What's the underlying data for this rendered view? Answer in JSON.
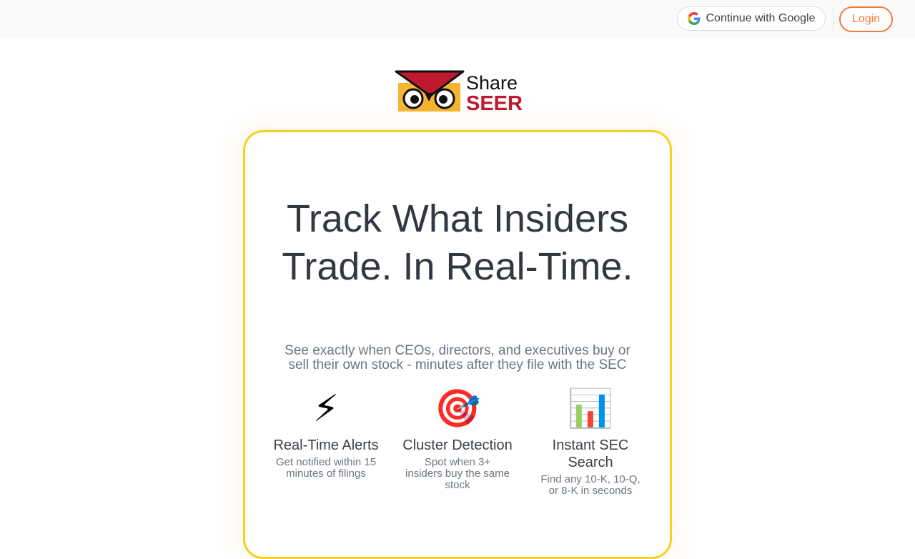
{
  "header": {
    "google_button_label": "Continue with Google",
    "login_label": "Login"
  },
  "logo": {
    "line1": "Share",
    "line2": "SEER"
  },
  "hero": {
    "headline_line1": "Track What Insiders",
    "headline_line2": "Trade. In Real-Time.",
    "subtitle_line1": "See exactly when CEOs, directors, and executives buy or",
    "subtitle_line2": "sell their own stock - minutes after they file with the SEC"
  },
  "features": [
    {
      "icon": "lightning-icon",
      "glyph": "⚡",
      "title": "Real-Time Alerts",
      "desc_line1": "Get notified within 15",
      "desc_line2": "minutes of filings",
      "desc_line3": ""
    },
    {
      "icon": "target-icon",
      "glyph": "🎯",
      "title": "Cluster Detection",
      "desc_line1": "Spot when 3+",
      "desc_line2": "insiders buy the same",
      "desc_line3": "stock"
    },
    {
      "icon": "bar-chart-icon",
      "glyph": "📊",
      "title_line1": "Instant SEC",
      "title_line2": "Search",
      "desc_line1": "Find any 10-K, 10-Q,",
      "desc_line2": "or 8-K in seconds"
    }
  ],
  "colors": {
    "accent_orange": "#f07a3c",
    "card_border_yellow": "#f5d11c",
    "logo_red": "#c0182e",
    "logo_yellow": "#f6b431",
    "heading_text": "#333840",
    "muted_text": "#6d7580"
  }
}
